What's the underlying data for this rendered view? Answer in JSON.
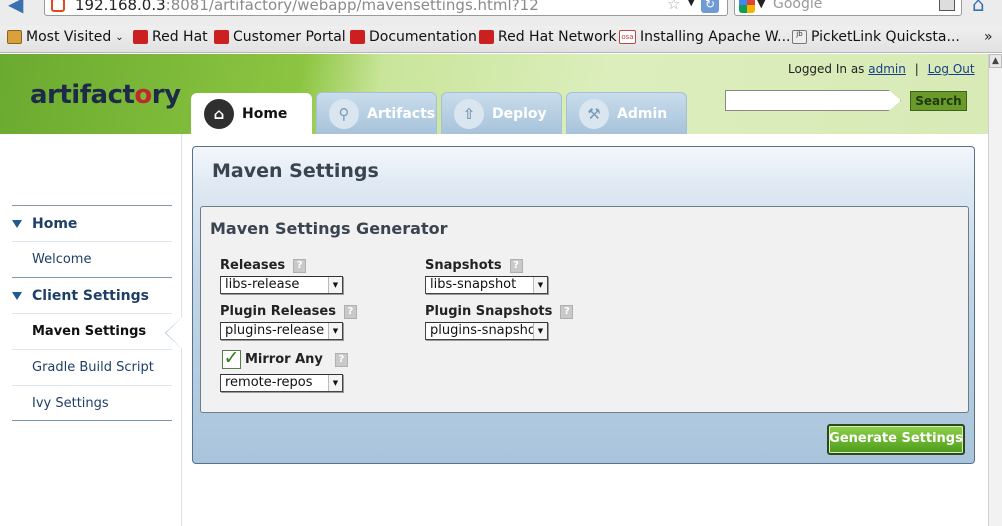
{
  "browser": {
    "url_host": "192.168.0.3",
    "url_path": ":8081/artifactory/webapp/mavensettings.html?12",
    "search_placeholder": "Google",
    "bookmarks": [
      "Most Visited",
      "Red Hat",
      "Customer Portal",
      "Documentation",
      "Red Hat Network",
      "Installing Apache W...",
      "PicketLink Quicksta..."
    ],
    "bookmark_icons": [
      "folder-icon",
      "redhat-icon",
      "redhat-icon",
      "redhat-icon",
      "redhat-icon",
      "osa-icon",
      "jboss-icon"
    ],
    "more": "»"
  },
  "header": {
    "logo_part1": "artifact",
    "logo_o": "o",
    "logo_part2": "ry",
    "logged_in_as": "Logged In as",
    "user": "admin",
    "separator": "|",
    "logout": "Log Out",
    "search_button": "Search"
  },
  "tabs": [
    {
      "label": "Home",
      "icon": "home-icon",
      "active": true
    },
    {
      "label": "Artifacts",
      "icon": "search-icon",
      "active": false
    },
    {
      "label": "Deploy",
      "icon": "upload-icon",
      "active": false
    },
    {
      "label": "Admin",
      "icon": "wrench-icon",
      "active": false
    }
  ],
  "sidebar": {
    "sections": [
      {
        "label": "Home",
        "items": [
          "Welcome"
        ]
      },
      {
        "label": "Client Settings",
        "items": [
          "Maven Settings",
          "Gradle Build Script",
          "Ivy Settings"
        ]
      }
    ],
    "selected": "Maven Settings"
  },
  "panel": {
    "title": "Maven Settings",
    "generator_title": "Maven Settings Generator",
    "fields": {
      "releases": {
        "label": "Releases",
        "value": "libs-release"
      },
      "snapshots": {
        "label": "Snapshots",
        "value": "libs-snapshot"
      },
      "plugin_releases": {
        "label": "Plugin Releases",
        "value": "plugins-release"
      },
      "plugin_snapshots": {
        "label": "Plugin Snapshots",
        "value": "plugins-snapshot"
      },
      "mirror_any": {
        "label": "Mirror Any",
        "checked": true,
        "value": "remote-repos"
      }
    },
    "help": "?",
    "generate_button": "Generate Settings"
  }
}
